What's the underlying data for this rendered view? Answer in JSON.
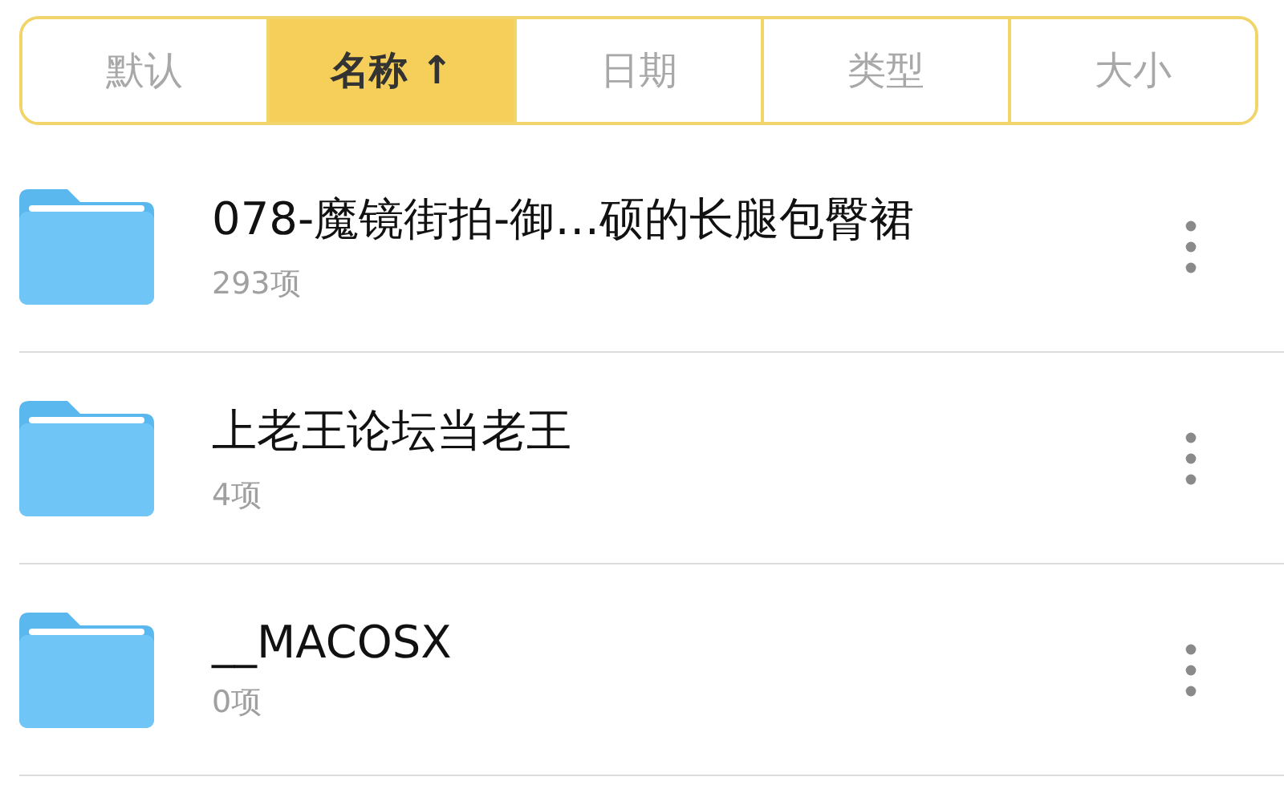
{
  "sort_tabs": [
    {
      "label": "默认",
      "selected": false
    },
    {
      "label": "名称 ↑",
      "selected": true
    },
    {
      "label": "日期",
      "selected": false
    },
    {
      "label": "类型",
      "selected": false
    },
    {
      "label": "大小",
      "selected": false
    }
  ],
  "folders": [
    {
      "name": "078-魔镜街拍-御…硕的长腿包臀裙",
      "count": "293项"
    },
    {
      "name": "上老王论坛当老王",
      "count": "4项"
    },
    {
      "name": "__MACOSX",
      "count": "0项"
    }
  ]
}
